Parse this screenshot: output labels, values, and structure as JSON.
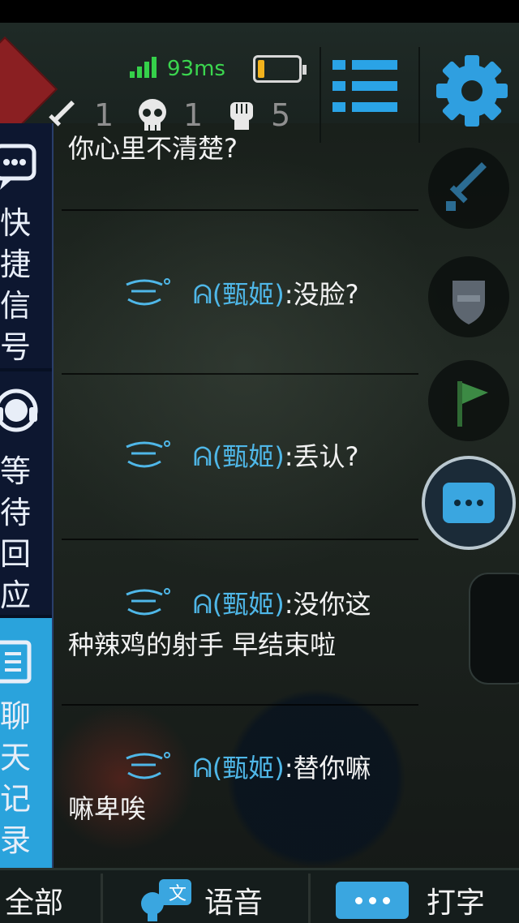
{
  "status": {
    "ping": "93ms",
    "battery_level": 0.15,
    "kills": "1",
    "deaths": "1",
    "assists": "5"
  },
  "side_panel": {
    "quick_signal": [
      "快",
      "捷",
      "信",
      "号"
    ],
    "waiting_reply": [
      "等",
      "待",
      "回",
      "应"
    ],
    "chat_history": [
      "聊",
      "天",
      "记",
      "录"
    ]
  },
  "messages": [
    {
      "sender": "",
      "text": "你心里不清楚?"
    },
    {
      "sender": "ᕱ(甄姬)",
      "text": ":没脸?"
    },
    {
      "sender": "ᕱ(甄姬)",
      "text": ":丢认?"
    },
    {
      "sender": "ᕱ(甄姬)",
      "text": ":没你这",
      "continuation": "种辣鸡的射手 早结束啦"
    },
    {
      "sender": "ᕱ(甄姬)",
      "text": ":替你嘛",
      "continuation": "嘛卑唉"
    }
  ],
  "tabs": {
    "all": "全部",
    "voice": "语音",
    "type": "打字"
  },
  "colors": {
    "accent": "#2aa3dc",
    "ping_green": "#3bd64f",
    "sender_blue": "#4fb7e8",
    "side_panel_bg": "#0d1730"
  },
  "icons": [
    "sword-icon",
    "skull-icon",
    "fist-icon",
    "menu-icon",
    "gear-icon",
    "speech-bubble-icon",
    "headset-icon",
    "list-icon",
    "shield-icon",
    "flag-icon",
    "chat-icon",
    "voice-icon",
    "keyboard-icon"
  ]
}
